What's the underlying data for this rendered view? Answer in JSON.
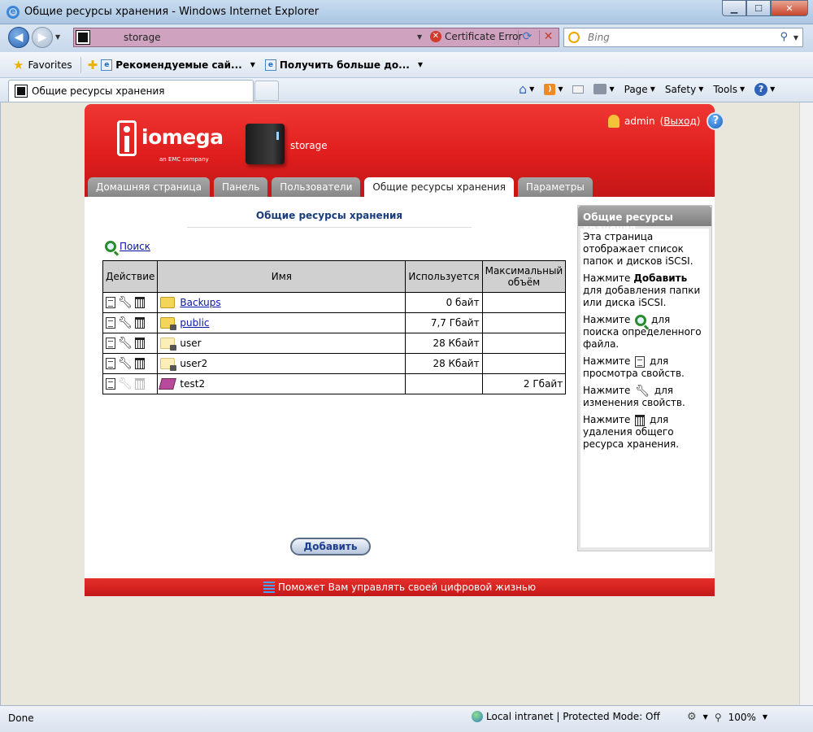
{
  "window": {
    "title": "Общие ресурсы хранения - Windows Internet Explorer",
    "minimize": "▁",
    "maximize": "☐",
    "close": "✕"
  },
  "address_bar": {
    "url": "storage",
    "certificate_error": "Certificate Error",
    "search_placeholder": "Bing"
  },
  "favorites_bar": {
    "favorites_label": "Favorites",
    "links": [
      "Рекомендуемые сай...",
      "Получить больше до..."
    ]
  },
  "browser_tab": {
    "label": "Общие ресурсы хранения"
  },
  "command_bar": {
    "page": "Page",
    "safety": "Safety",
    "tools": "Tools"
  },
  "header": {
    "brand": "iomega",
    "tagline": "an EMC company",
    "device_name": "storage",
    "user": "admin",
    "logout_open": "(",
    "logout": "Выход",
    "logout_close": ")"
  },
  "nav_tabs": [
    {
      "label": "Домашняя страница"
    },
    {
      "label": "Панель"
    },
    {
      "label": "Пользователи"
    },
    {
      "label": "Общие ресурсы хранения",
      "active": true
    },
    {
      "label": "Параметры"
    }
  ],
  "main": {
    "title": "Общие ресурсы хранения",
    "search_link": "Поиск",
    "table": {
      "headers": [
        "Действие",
        "Имя",
        "Используется",
        "Максимальный объём"
      ],
      "rows": [
        {
          "name": "Backups",
          "link": true,
          "used": "0 байт",
          "max": "",
          "icon": "shared-folder-icon"
        },
        {
          "name": "public",
          "link": true,
          "used": "7,7 Гбайт",
          "max": "",
          "icon": "locked-folder-icon"
        },
        {
          "name": "user",
          "link": false,
          "used": "28 Кбайт",
          "max": "",
          "icon": "locked-folder-icon"
        },
        {
          "name": "user2",
          "link": false,
          "used": "28 Кбайт",
          "max": "",
          "icon": "locked-folder-icon"
        },
        {
          "name": "test2",
          "link": false,
          "used": "",
          "max": "2 Гбайт",
          "icon": "iscsi-disk-icon"
        }
      ]
    },
    "add_button": "Добавить"
  },
  "help_panel": {
    "title": "Общие ресурсы хранения",
    "p1": "Эта страница отображает список папок и дисков iSCSI.",
    "p2_a": "Нажмите ",
    "p2_bold": "Добавить",
    "p2_b": " для добавления папки или диска iSCSI.",
    "p3_a": "Нажмите ",
    "p3_b": " для поиска определенного файла.",
    "p4_a": "Нажмите ",
    "p4_b": " для просмотра свойств.",
    "p5_a": "Нажмите ",
    "p5_b": " для изменения свойств.",
    "p6_a": "Нажмите ",
    "p6_b": " для удаления общего ресурса хранения."
  },
  "footer": {
    "text": "Поможет Вам управлять своей цифровой жизнью"
  },
  "status_bar": {
    "status": "Done",
    "zone": "Local intranet | Protected Mode: Off",
    "zoom": "100%"
  },
  "colors": {
    "brand_red": "#df1e1d",
    "link_blue": "#0a15a8"
  }
}
